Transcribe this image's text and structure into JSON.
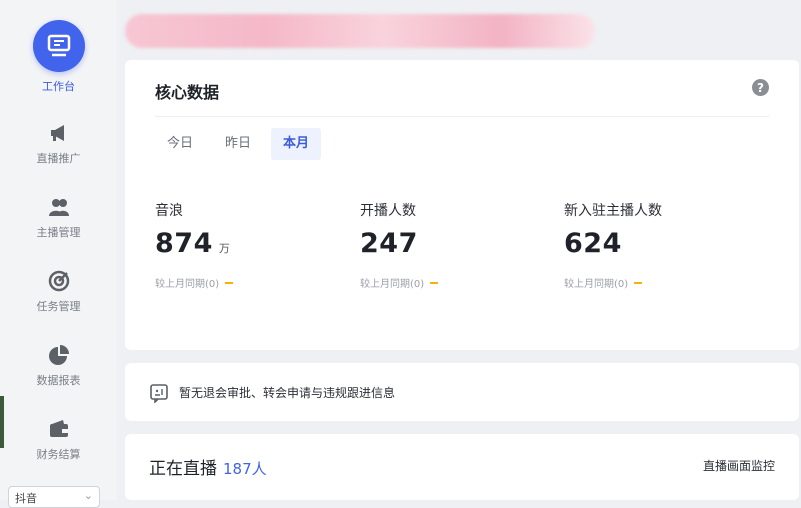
{
  "sidebar": {
    "items": [
      {
        "label": "工作台",
        "icon": "monitor-icon",
        "active": true
      },
      {
        "label": "直播推广",
        "icon": "megaphone-icon",
        "active": false
      },
      {
        "label": "主播管理",
        "icon": "users-icon",
        "active": false
      },
      {
        "label": "任务管理",
        "icon": "target-icon",
        "active": false
      },
      {
        "label": "数据报表",
        "icon": "pie-chart-icon",
        "active": false
      },
      {
        "label": "财务结算",
        "icon": "wallet-icon",
        "active": false
      }
    ],
    "select_value": "抖音"
  },
  "core": {
    "title": "核心数据",
    "tabs": [
      "今日",
      "昨日",
      "本月"
    ],
    "active_tab": "本月",
    "metrics": [
      {
        "label": "音浪",
        "value": "874",
        "unit": "万",
        "compare": "较上月同期(0)"
      },
      {
        "label": "开播人数",
        "value": "247",
        "unit": "",
        "compare": "较上月同期(0)"
      },
      {
        "label": "新入驻主播人数",
        "value": "624",
        "unit": "",
        "compare": "较上月同期(0)"
      }
    ]
  },
  "notice": {
    "text": "暂无退会审批、转会申请与违规跟进信息"
  },
  "live": {
    "title": "正在直播",
    "count": "187人",
    "link": "直播画面监控"
  },
  "colors": {
    "accent": "#4263eb",
    "sidebar_bg": "#f3f4f6",
    "page_bg": "#eef0f3",
    "dash": "#f5b400"
  }
}
